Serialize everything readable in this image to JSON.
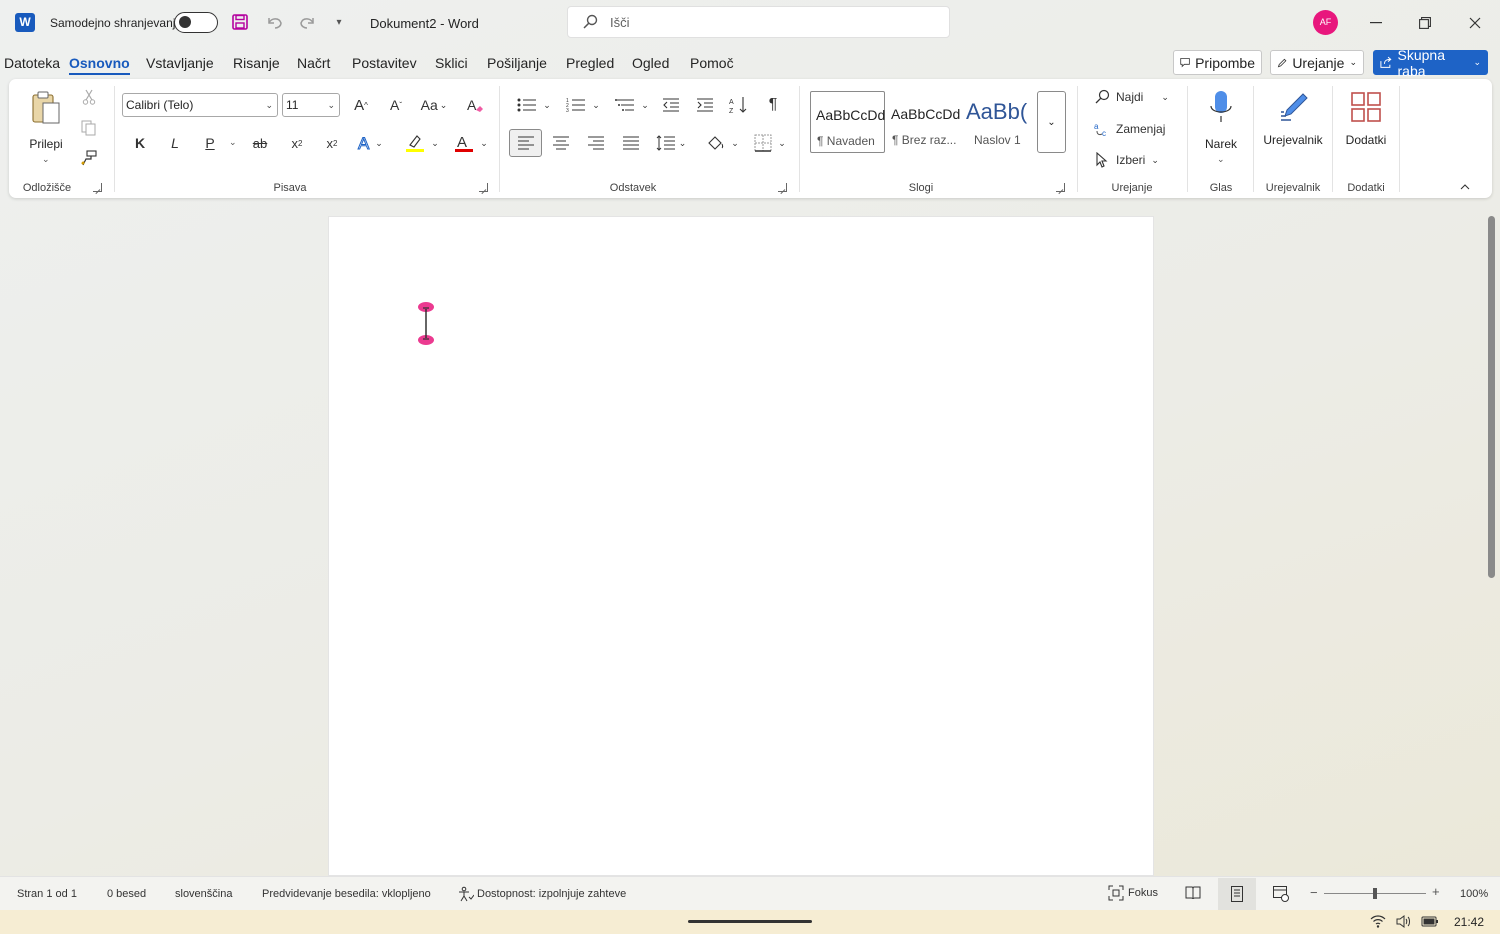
{
  "titlebar": {
    "app_icon": "W",
    "autosave_label": "Samodejno shranjevanje",
    "autosave_state": "off",
    "document_title": "Dokument2  -  Word",
    "search_placeholder": "Išči",
    "avatar_initials": "AF"
  },
  "menu": {
    "tabs": [
      "Datoteka",
      "Osnovno",
      "Vstavljanje",
      "Risanje",
      "Načrt",
      "Postavitev",
      "Sklici",
      "Pošiljanje",
      "Pregled",
      "Ogled",
      "Pomoč"
    ],
    "active_tab": "Osnovno",
    "comments_label": "Pripombe",
    "editing_label": "Urejanje",
    "share_label": "Skupna raba"
  },
  "ribbon": {
    "clipboard": {
      "paste_label": "Prilepi",
      "group_label": "Odložišče"
    },
    "font": {
      "font_name": "Calibri (Telo)",
      "font_size": "11",
      "grow_label": "A",
      "shrink_label": "A",
      "case_label": "Aa",
      "bold": "K",
      "italic": "L",
      "underline": "P",
      "strike": "ab",
      "subscript": "x",
      "superscript": "x",
      "group_label": "Pisava"
    },
    "paragraph": {
      "group_label": "Odstavek"
    },
    "styles": {
      "items": [
        {
          "sample": "AaBbCcDd",
          "name": "¶ Navaden"
        },
        {
          "sample": "AaBbCcDd",
          "name": "¶ Brez raz..."
        },
        {
          "sample": "AaBb(",
          "name": "Naslov 1"
        }
      ],
      "group_label": "Slogi"
    },
    "editing": {
      "find": "Najdi",
      "replace": "Zamenjaj",
      "select": "Izberi",
      "group_label": "Urejanje"
    },
    "voice": {
      "dictate": "Narek",
      "group_label": "Glas"
    },
    "editor": {
      "label": "Urejevalnik",
      "group_label": "Urejevalnik"
    },
    "addins": {
      "label": "Dodatki",
      "group_label": "Dodatki"
    }
  },
  "status": {
    "page": "Stran 1 od 1",
    "words": "0 besed",
    "language": "slovenščina",
    "prediction": "Predvidevanje besedila: vklopljeno",
    "accessibility": "Dostopnost: izpolnjuje zahteve",
    "focus": "Fokus",
    "zoom": "100%",
    "zoom_fraction": 0.5
  },
  "taskbar": {
    "time": "21:42"
  },
  "colors": {
    "accent": "#185abd",
    "share": "#1e63c6",
    "avatar": "#e8177d",
    "highlight": "#ffff00",
    "font_color": "#e00000"
  }
}
